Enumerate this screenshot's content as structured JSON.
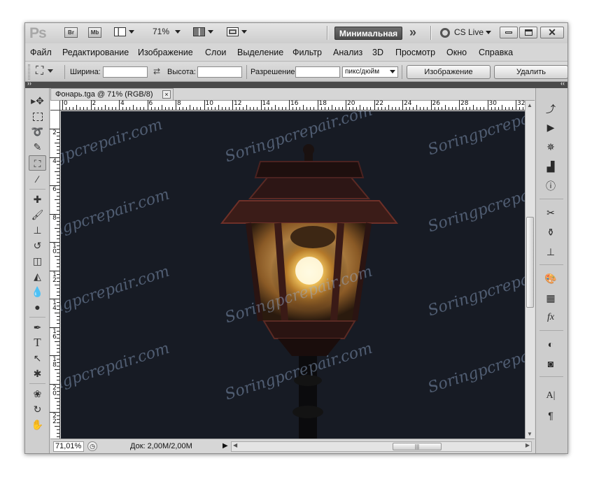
{
  "appbar": {
    "logo": "Ps",
    "bridge": "Br",
    "minibridge": "Mb",
    "zoom": "71%",
    "workspace_button": "Минимальная",
    "more": "»",
    "cs_live": "CS Live"
  },
  "menu": [
    "Файл",
    "Редактирование",
    "Изображение",
    "Слои",
    "Выделение",
    "Фильтр",
    "Анализ",
    "3D",
    "Просмотр",
    "Окно",
    "Справка"
  ],
  "options": {
    "width_label": "Ширина:",
    "width_value": "",
    "height_label": "Высота:",
    "height_value": "",
    "resolution_label": "Разрешение:",
    "resolution_value": "",
    "units": "пикс/дюйм",
    "image_button": "Изображение",
    "delete_button": "Удалить"
  },
  "document": {
    "tab_title": "Фонарь.tga @ 71% (RGB/8)",
    "close": "×"
  },
  "rulers": {
    "horizontal": [
      "0",
      "2",
      "4",
      "6",
      "8",
      "10",
      "12",
      "14",
      "16",
      "18",
      "20",
      "22",
      "24",
      "26",
      "28",
      "30",
      "32"
    ],
    "vertical": [
      "2",
      "4",
      "6",
      "8",
      "10",
      "12",
      "14",
      "16",
      "18",
      "20",
      "22"
    ]
  },
  "status": {
    "zoom": "71,01%",
    "doc_info": "Док: 2,00M/2,00M"
  },
  "watermark": "Soringpcrepair.com",
  "colors": {
    "canvas_bg": "#171b24",
    "glow": "#ffd66a",
    "workspace_btn": "#555555"
  }
}
